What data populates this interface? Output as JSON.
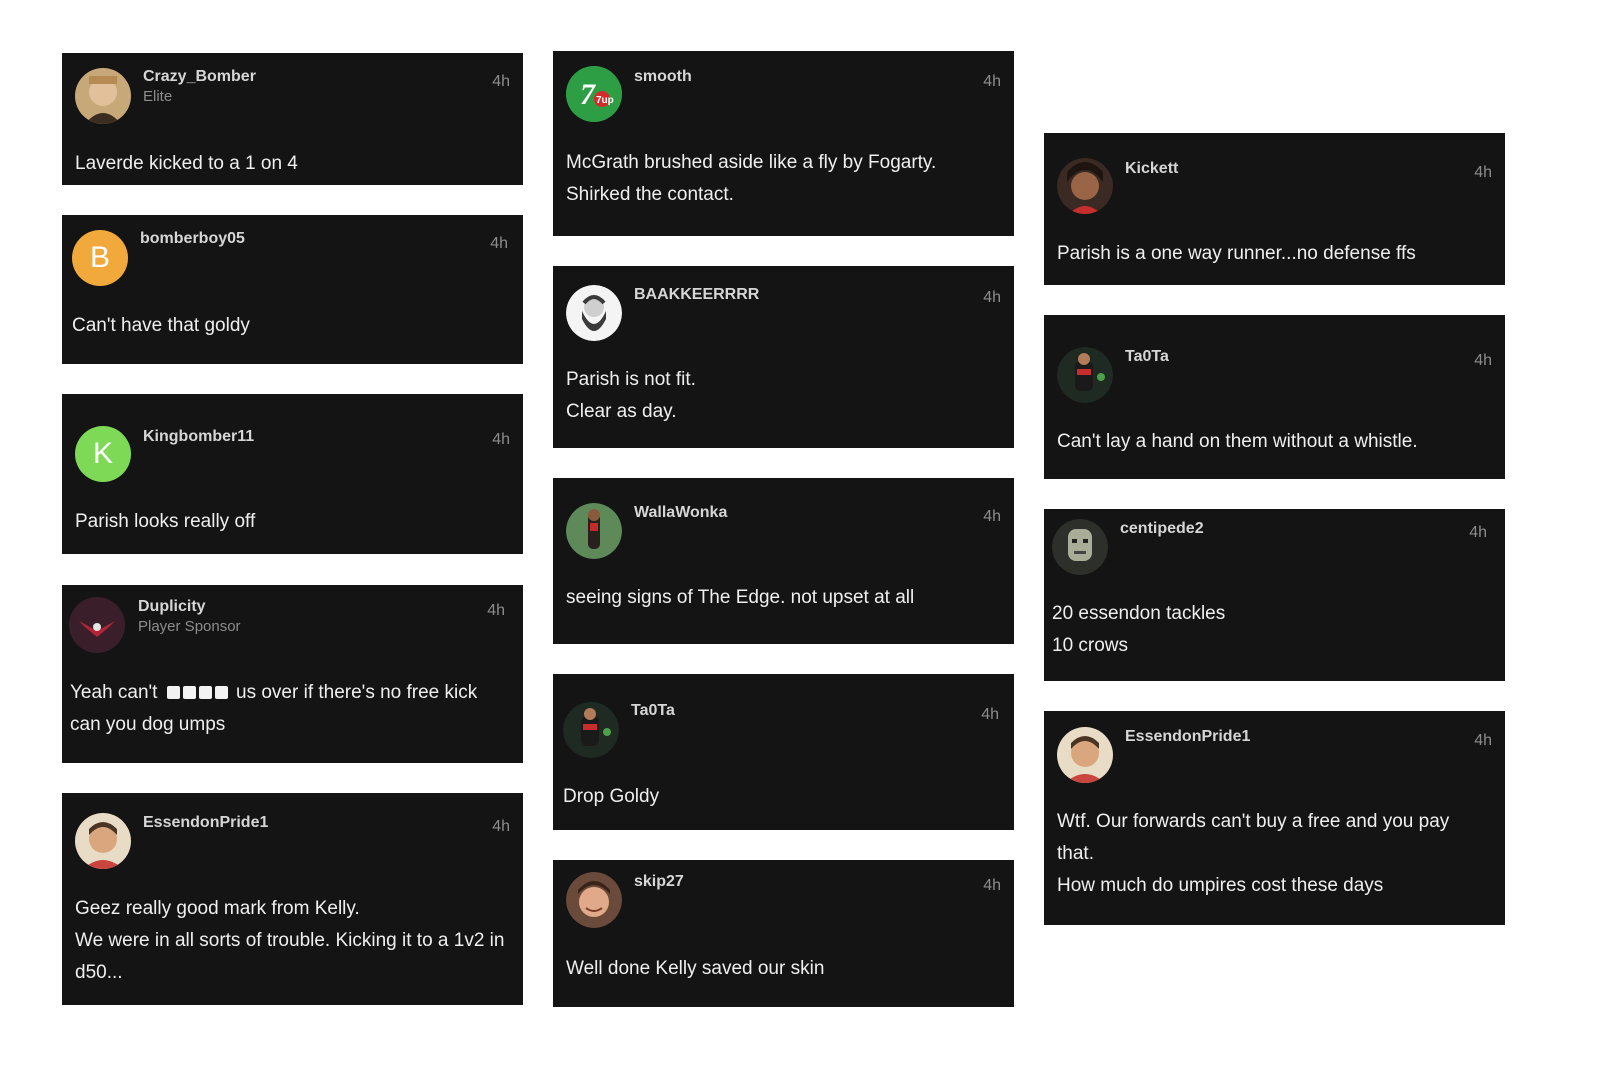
{
  "colors": {
    "card_bg": "#141415",
    "page_bg": "#ffffff",
    "avatar_b": "#f2a93b",
    "avatar_k": "#7ed957",
    "avatar_7up": "#2e9e44"
  },
  "comments": [
    {
      "user": "Crazy_Bomber",
      "role": "Elite",
      "time": "4h",
      "avatar": "photo-man-icon",
      "lines": [
        "Laverde kicked to a 1 on 4"
      ]
    },
    {
      "user": "bomberboy05",
      "time": "4h",
      "avatar_letter": "B",
      "lines": [
        "Can't have that goldy"
      ]
    },
    {
      "user": "Kingbomber11",
      "time": "4h",
      "avatar_letter": "K",
      "lines": [
        "Parish looks really off"
      ]
    },
    {
      "user": "Duplicity",
      "role": "Player Sponsor",
      "time": "4h",
      "avatar": "emblem-icon",
      "lines": [
        "Yeah can't",
        "us over if there's no free kick",
        "can you dog umps"
      ]
    },
    {
      "user": "EssendonPride1",
      "time": "4h",
      "avatar": "photo-man-icon",
      "lines": [
        "Geez really good mark from Kelly.",
        "We were in all sorts of trouble. Kicking it to a 1v2 in d50..."
      ]
    },
    {
      "user": "smooth",
      "time": "4h",
      "avatar": "7up-logo-icon",
      "avatar_text": "7up",
      "lines": [
        "McGrath brushed aside like a fly by Fogarty.",
        "Shirked the contact."
      ]
    },
    {
      "user": "BAAKKEERRRR",
      "time": "4h",
      "avatar": "portrait-engraving-icon",
      "lines": [
        "Parish is not fit.",
        "Clear as day."
      ]
    },
    {
      "user": "WallaWonka",
      "time": "4h",
      "avatar": "photo-player-icon",
      "lines": [
        "seeing signs of The Edge. not upset at all"
      ]
    },
    {
      "user": "Ta0Ta",
      "time": "4h",
      "avatar": "photo-player-icon",
      "lines": [
        "Drop Goldy"
      ]
    },
    {
      "user": "skip27",
      "time": "4h",
      "avatar": "photo-man-icon",
      "lines": [
        "Well done Kelly saved our skin"
      ]
    },
    {
      "user": "Kickett",
      "time": "4h",
      "avatar": "photo-man-icon",
      "lines": [
        "Parish is a one way runner...no defense ffs"
      ]
    },
    {
      "user": "Ta0Ta",
      "time": "4h",
      "avatar": "photo-player-icon",
      "lines": [
        "Can't lay a hand on them without a whistle."
      ]
    },
    {
      "user": "centipede2",
      "time": "4h",
      "avatar": "photo-face-icon",
      "lines": [
        "20 essendon tackles",
        "10 crows"
      ]
    },
    {
      "user": "EssendonPride1",
      "time": "4h",
      "avatar": "photo-man-icon",
      "lines": [
        "Wtf. Our forwards can't buy a free and you pay that.",
        "How much do umpires cost these days"
      ]
    }
  ]
}
